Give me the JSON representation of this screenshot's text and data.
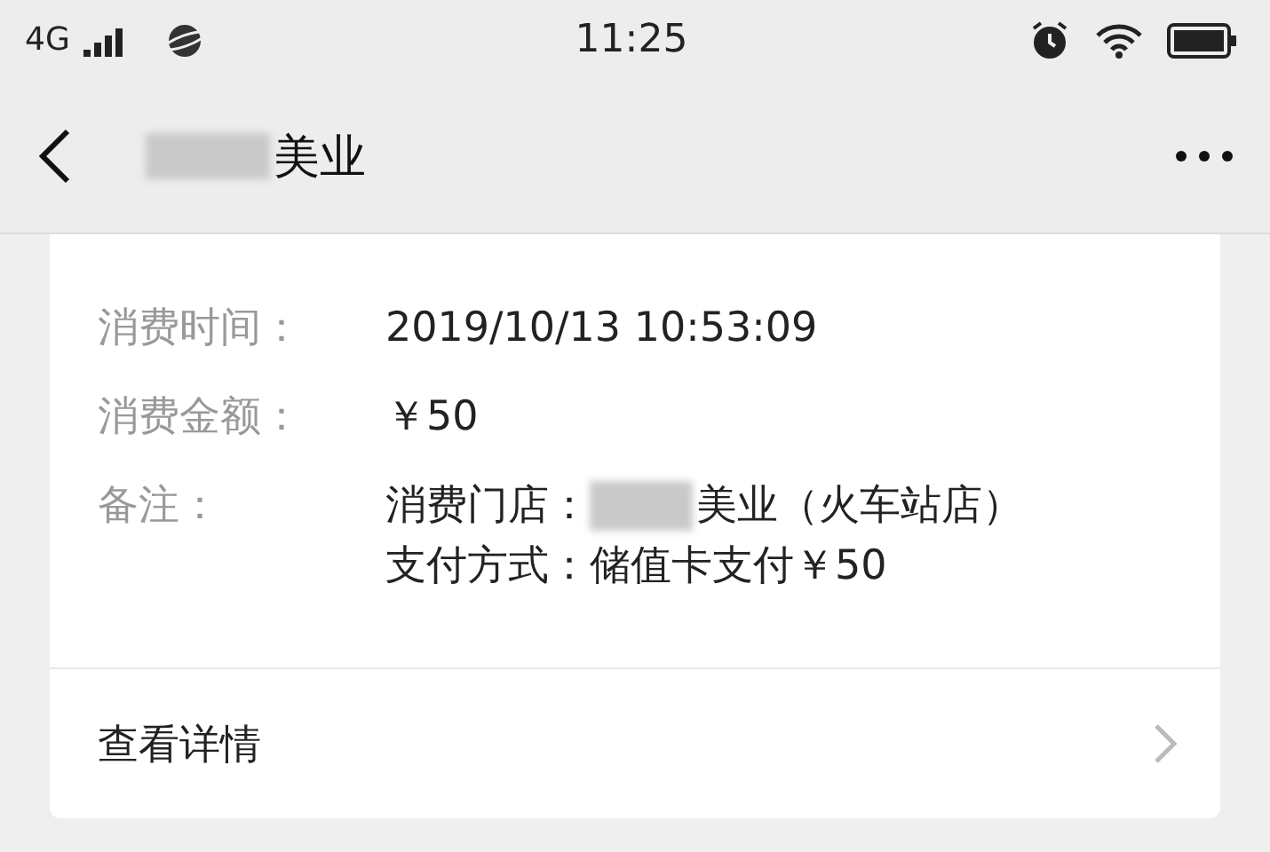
{
  "status_bar": {
    "network": "4G",
    "time": "11:25"
  },
  "nav": {
    "title": "美业",
    "title_redacted": true
  },
  "record": {
    "fields": [
      {
        "label": "消费时间：",
        "lines": [
          {
            "redacted": false,
            "text": "2019/10/13 10:53:09"
          }
        ]
      },
      {
        "label": "消费金额：",
        "lines": [
          {
            "redacted": false,
            "text": "￥50"
          }
        ]
      },
      {
        "label": "备注：",
        "lines": [
          {
            "prefix": "消费门店：",
            "redacted": true,
            "text": "美业（火车站店）"
          },
          {
            "prefix": "支付方式：",
            "redacted": false,
            "text": "储值卡支付￥50"
          }
        ]
      }
    ],
    "link": "查看详情"
  }
}
